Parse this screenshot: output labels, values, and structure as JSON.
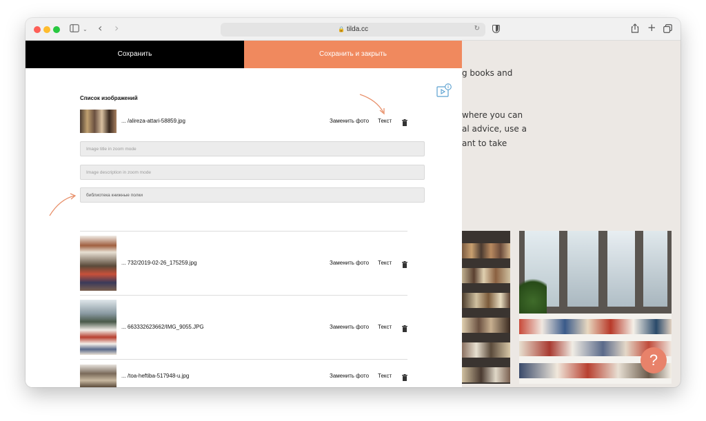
{
  "browser": {
    "url": "tilda.cc"
  },
  "background_page": {
    "lines": [
      "g books and",
      "where you can",
      "al advice, use a",
      "ant to take"
    ],
    "help_label": "?"
  },
  "editor": {
    "save_label": "Сохранить",
    "save_close_label": "Сохранить и закрыть",
    "list_title": "Список изображений",
    "replace_label": "Заменить фото",
    "text_label": "Текст",
    "fields": {
      "title_placeholder": "Image title in zoom mode",
      "description_placeholder": "Image description in zoom mode",
      "alt_value": "библиотека книжные полки"
    },
    "items": [
      {
        "file": "... /alireza-attari-58859.jpg"
      },
      {
        "file": "... 732/2019-02-26_175259.jpg"
      },
      {
        "file": "... 663332623662/IMG_9055.JPG"
      },
      {
        "file": "... /toa-heftiba-517948-u.jpg"
      }
    ]
  },
  "colors": {
    "accent": "#f0895e",
    "save_bg": "#000000",
    "page_bg": "#ece8e4"
  }
}
